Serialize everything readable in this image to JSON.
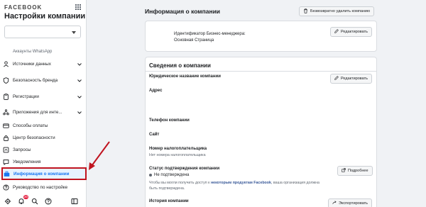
{
  "sidebar": {
    "brand": "FACEBOOK",
    "title": "Настройки компании",
    "selector_value": "",
    "section_label": "Аккаунты WhatsApp",
    "items": [
      {
        "label": "Источники данных",
        "icon": "data-sources-icon",
        "chevron": "down"
      },
      {
        "label": "Безопасность бренда",
        "icon": "shield-icon",
        "chevron": "down"
      },
      {
        "label": "Регистрации",
        "icon": "clipboard-icon",
        "chevron": "down"
      },
      {
        "label": "Приложения для инте...",
        "icon": "integrations-icon",
        "chevron": "down"
      },
      {
        "label": "Способы оплаты",
        "icon": "card-icon",
        "chevron": ""
      },
      {
        "label": "Центр безопасности",
        "icon": "lock-icon",
        "chevron": ""
      },
      {
        "label": "Запросы",
        "icon": "requests-icon",
        "chevron": ""
      },
      {
        "label": "Уведомления",
        "icon": "notifications-icon",
        "chevron": ""
      },
      {
        "label": "Информация о компании",
        "icon": "briefcase-icon",
        "chevron": "",
        "active": true
      },
      {
        "label": "Руководство по настройке",
        "icon": "help-icon",
        "chevron": ""
      }
    ],
    "bottom_badge": "20"
  },
  "main": {
    "title": "Информация о компании",
    "delete_button": "Безвозвратно удалить компанию",
    "id_card": {
      "label": "Идентификатор Бизнес-менеджера:",
      "value": "Основная Страница",
      "edit": "Редактировать"
    },
    "details": {
      "title": "Сведения о компании",
      "edit": "Редактировать",
      "legal_name_label": "Юридическое название компании",
      "address_label": "Адрес",
      "phone_label": "Телефон компании",
      "site_label": "Сайт",
      "tax_label": "Номер налогоплательщика",
      "tax_value": "Нет номера налогоплательщика",
      "verification_label": "Статус подтверждения компании",
      "verification_value": "Не подтверждена",
      "more_button": "Подробнее",
      "verification_note_1": "Чтобы вы могли получить доступ к",
      "verification_link": "некоторым продуктам Facebook",
      "verification_note_2": ", ваша организация должна",
      "verification_note_3": "быть подтверждена.",
      "history_label": "История компании",
      "export_button": "Экспортировать"
    }
  },
  "colors": {
    "accent": "#1877f2",
    "highlight_border": "#c0141f",
    "arrow": "#c0141f",
    "background": "#f0f2f5"
  }
}
